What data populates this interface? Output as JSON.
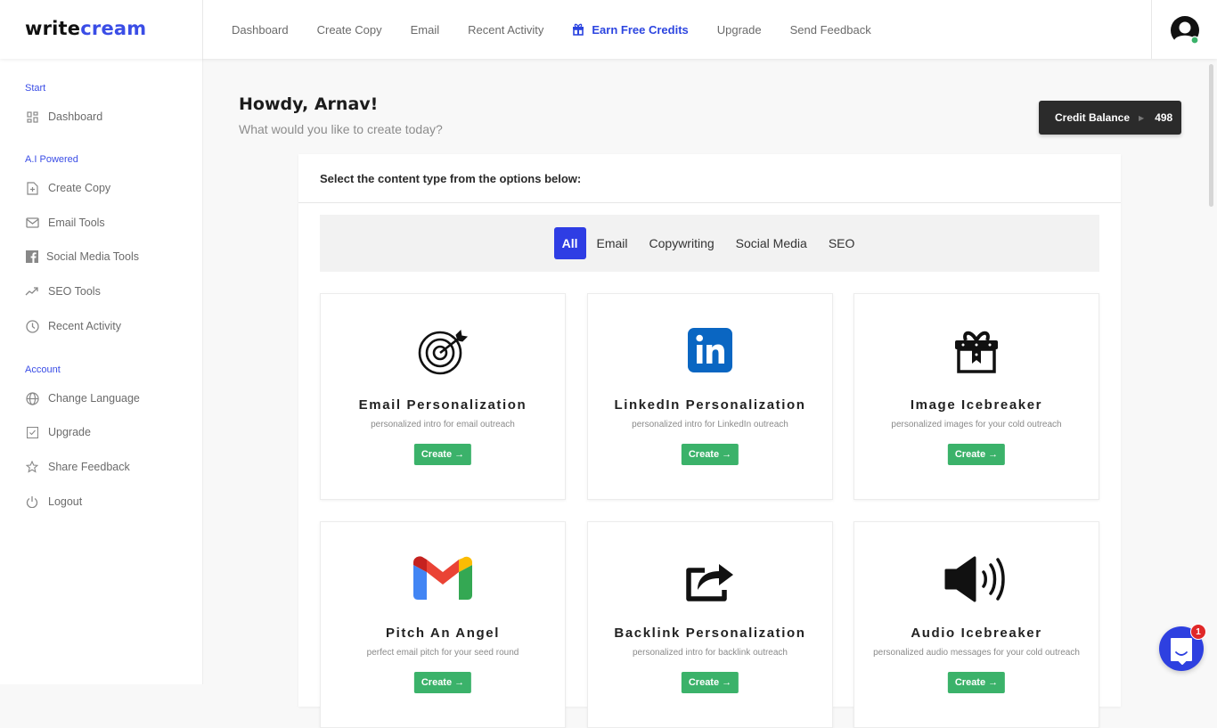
{
  "brand": {
    "part1": "write",
    "part2": "cream"
  },
  "topnav": [
    {
      "label": "Dashboard"
    },
    {
      "label": "Create Copy"
    },
    {
      "label": "Email"
    },
    {
      "label": "Recent Activity"
    },
    {
      "label": "Earn Free Credits",
      "icon": "gift-icon",
      "highlight": true
    },
    {
      "label": "Upgrade"
    },
    {
      "label": "Send Feedback"
    }
  ],
  "user": {
    "status": "online"
  },
  "sidebar": {
    "sections": [
      {
        "label": "Start"
      },
      {
        "label": "A.I Powered"
      },
      {
        "label": "Account"
      }
    ],
    "items": [
      {
        "label": "Dashboard",
        "icon": "grid-icon"
      },
      {
        "label": "Create Copy",
        "icon": "file-plus-icon"
      },
      {
        "label": "Email Tools",
        "icon": "envelope-icon"
      },
      {
        "label": "Social Media Tools",
        "icon": "facebook-icon"
      },
      {
        "label": "SEO Tools",
        "icon": "trending-up-icon"
      },
      {
        "label": "Recent Activity",
        "icon": "clock-icon"
      },
      {
        "label": "Change Language",
        "icon": "globe-icon"
      },
      {
        "label": "Upgrade",
        "icon": "check-square-icon"
      },
      {
        "label": "Share Feedback",
        "icon": "star-icon"
      },
      {
        "label": "Logout",
        "icon": "power-icon"
      }
    ]
  },
  "main": {
    "greeting": "Howdy, Arnav!",
    "subtitle": "What would you like to create today?",
    "credit": {
      "label": "Credit Balance",
      "value": "498"
    },
    "panel_title": "Select the content type from the options below:",
    "filters": [
      {
        "label": "All",
        "active": true
      },
      {
        "label": "Email"
      },
      {
        "label": "Copywriting"
      },
      {
        "label": "Social Media"
      },
      {
        "label": "SEO"
      }
    ],
    "cards": [
      {
        "title": "Email Personalization",
        "desc": "personalized intro for email outreach",
        "button": "Create →",
        "icon": "target-icon"
      },
      {
        "title": "LinkedIn Personalization",
        "desc": "personalized intro for LinkedIn outreach",
        "button": "Create →",
        "icon": "linkedin-icon"
      },
      {
        "title": "Image Icebreaker",
        "desc": "personalized images for your cold outreach",
        "button": "Create →",
        "icon": "gift-box-icon"
      },
      {
        "title": "Pitch An Angel",
        "desc": "perfect email pitch for your seed round",
        "button": "Create →",
        "icon": "gmail-icon"
      },
      {
        "title": "Backlink Personalization",
        "desc": "personalized intro for backlink outreach",
        "button": "Create →",
        "icon": "share-icon"
      },
      {
        "title": "Audio Icebreaker",
        "desc": "personalized audio messages for your cold outreach",
        "button": "Create →",
        "icon": "speaker-icon"
      }
    ]
  },
  "chat": {
    "badge": "1"
  },
  "colors": {
    "accent": "#2e3de4",
    "success": "#3bb26a",
    "dark": "#2b2b2b"
  }
}
